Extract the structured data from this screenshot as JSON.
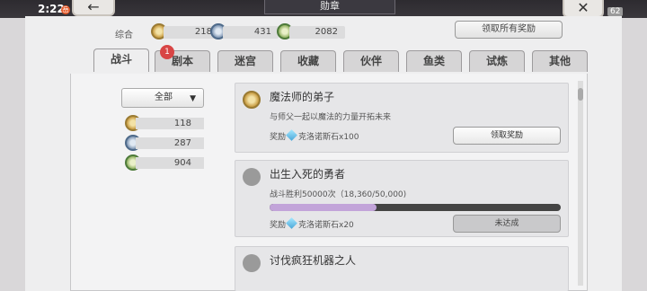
{
  "status": {
    "time": "2:22",
    "dot": "岳",
    "battery": "62"
  },
  "header": {
    "title": "勋章",
    "back_icon": "back-arrow-icon",
    "close_icon": "close-icon"
  },
  "summary": {
    "label": "综合",
    "gold": "218",
    "silver": "431",
    "bronze": "2082",
    "claim_all": "领取所有奖励"
  },
  "tabs": [
    {
      "label": "战斗",
      "active": true
    },
    {
      "label": "剧本"
    },
    {
      "label": "迷宫"
    },
    {
      "label": "收藏"
    },
    {
      "label": "伙伴"
    },
    {
      "label": "鱼类"
    },
    {
      "label": "试炼"
    },
    {
      "label": "其他"
    }
  ],
  "badge": "1",
  "filter": {
    "label": "全部",
    "arrow": "▼"
  },
  "counts": [
    "118",
    "287",
    "904"
  ],
  "cards": [
    {
      "title": "魔法师的弟子",
      "desc": "与师父一起以魔法的力量开拓未来",
      "reward_label": "奖励",
      "reward": "克洛诺斯石x100",
      "button": "领取奖励"
    },
    {
      "title": "出生入死的勇者",
      "desc": "战斗胜利50000次（18,360/50,000)",
      "progress": 0.3672,
      "reward_label": "奖励",
      "reward": "克洛诺斯石x20",
      "button": "未达成"
    },
    {
      "title": "讨伐疯狂机器之人",
      "desc": "",
      "reward_label": "",
      "reward": "",
      "button": ""
    }
  ]
}
